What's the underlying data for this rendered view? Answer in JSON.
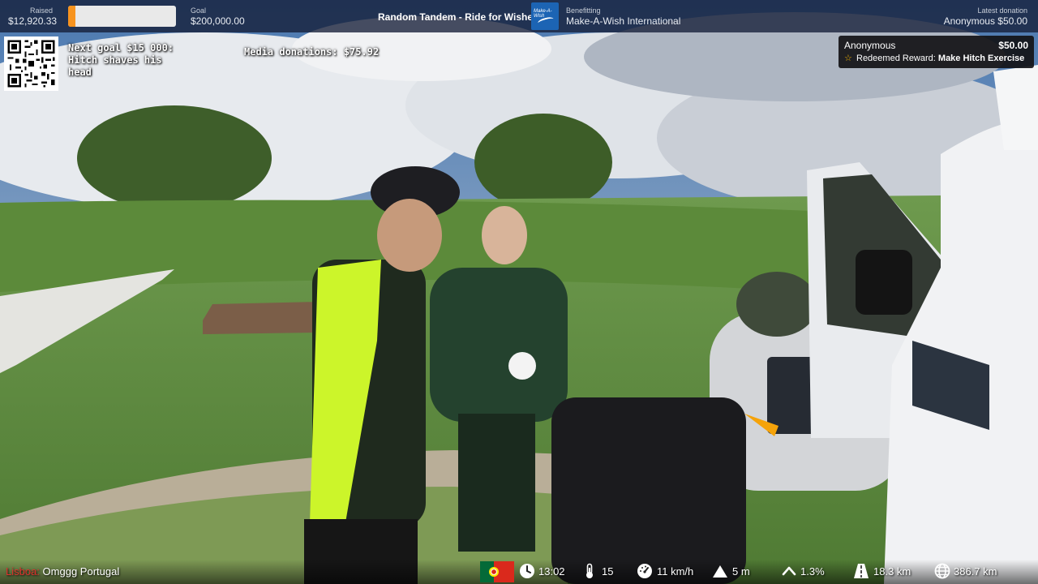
{
  "topbar": {
    "raised_label": "Raised",
    "raised_value": "$12,920.33",
    "progress_fraction": 0.065,
    "goal_label": "Goal",
    "goal_value": "$200,000.00",
    "stream_title": "Random Tandem - Ride for Wishes",
    "logo_text": "Make-A-Wish",
    "benefitting_label": "Benefitting",
    "benefitting_value": "Make-A-Wish International",
    "latest_label": "Latest donation",
    "latest_value": "Anonymous $50.00"
  },
  "overlay": {
    "next_goal": "Next goal $15 000: Hitch shaves his head",
    "media_donations": "Media donations: $75.92"
  },
  "alert": {
    "name": "Anonymous",
    "amount": "$50.00",
    "reward_prefix": "Redeemed Reward:",
    "reward_name": "Make Hitch Exercise"
  },
  "bottombar": {
    "location_red": "Lisboa:",
    "location": "Omggg Portugal",
    "time": "13:02",
    "temperature": "15",
    "speed": "11 km/h",
    "altitude": "5 m",
    "grade": "1.3%",
    "distance": "18.3 km",
    "total_distance": "386.7 km"
  },
  "icons": [
    "portugal-flag-icon",
    "clock-icon",
    "thermometer-icon",
    "speedometer-icon",
    "mountain-icon",
    "grade-up-icon",
    "road-icon",
    "globe-icon",
    "star-icon",
    "qr-code-icon"
  ],
  "colors": {
    "progress": "#f7931e",
    "bar": "#141e37",
    "brand_blue": "#1c64b4",
    "location_red": "#e0322d"
  }
}
